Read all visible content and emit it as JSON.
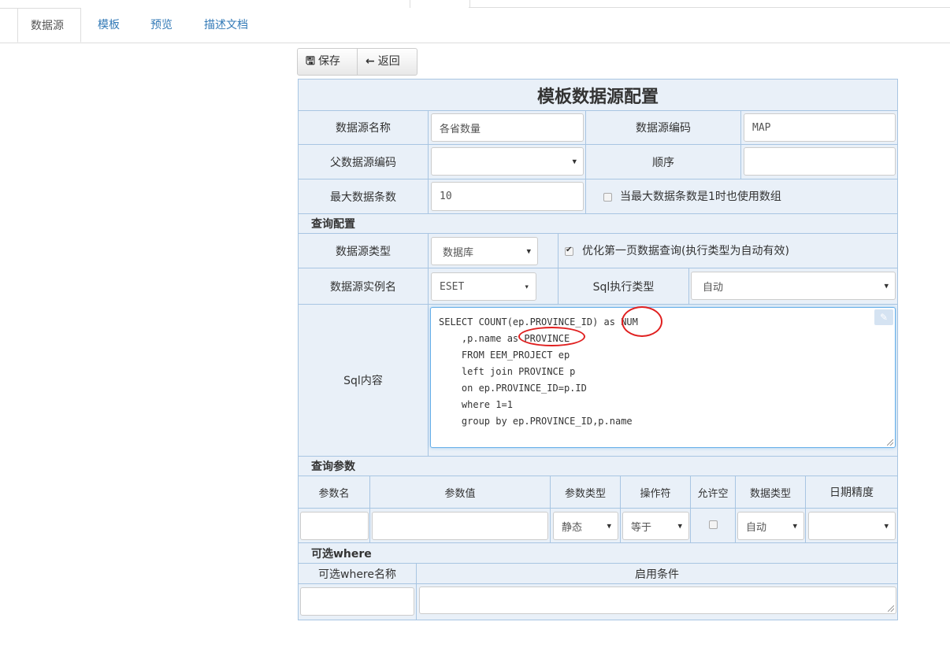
{
  "tabs": [
    "数据源",
    "模板",
    "预览",
    "描述文档"
  ],
  "toolbar": {
    "save": "保存",
    "back": "返回"
  },
  "form": {
    "title": "模板数据源配置",
    "ds_name_label": "数据源名称",
    "ds_name_value": "各省数量",
    "ds_code_label": "数据源编码",
    "ds_code_value": "MAP",
    "parent_code_label": "父数据源编码",
    "parent_code_value": "",
    "order_label": "顺序",
    "order_value": "",
    "max_rows_label": "最大数据条数",
    "max_rows_value": "10",
    "use_array_label": "当最大数据条数是1时也使用数组",
    "use_array_checked": false
  },
  "query_config": {
    "section": "查询配置",
    "ds_type_label": "数据源类型",
    "ds_type_value": "数据库",
    "optimize_label": "优化第一页数据查询(执行类型为自动有效)",
    "optimize_checked": true,
    "instance_label": "数据源实例名",
    "instance_value": "ESET",
    "exec_type_label": "Sql执行类型",
    "exec_type_value": "自动",
    "sql_label": "Sql内容",
    "sql_text": "SELECT COUNT(ep.PROVINCE_ID) as NUM\n    ,p.name as PROVINCE\n    FROM EEM_PROJECT ep\n    left join PROVINCE p\n    on ep.PROVINCE_ID=p.ID\n    where 1=1\n    group by ep.PROVINCE_ID,p.name"
  },
  "query_params": {
    "section": "查询参数",
    "headers": [
      "参数名",
      "参数值",
      "参数类型",
      "操作符",
      "允许空",
      "数据类型",
      "日期精度"
    ],
    "row": {
      "param_type": "静态",
      "operator": "等于",
      "allow_null": false,
      "data_type": "自动",
      "date_precision": ""
    }
  },
  "optional_where": {
    "section": "可选where",
    "headers": [
      "可选where名称",
      "启用条件"
    ]
  },
  "colors": {
    "accent": "#337ab7",
    "panel_bg": "#e9f0f8",
    "panel_border": "#a8c5e2",
    "annotation": "#e02020"
  },
  "icons": {
    "save": "floppy-disk-icon",
    "back": "arrow-left-icon",
    "edit": "edit-icon"
  }
}
